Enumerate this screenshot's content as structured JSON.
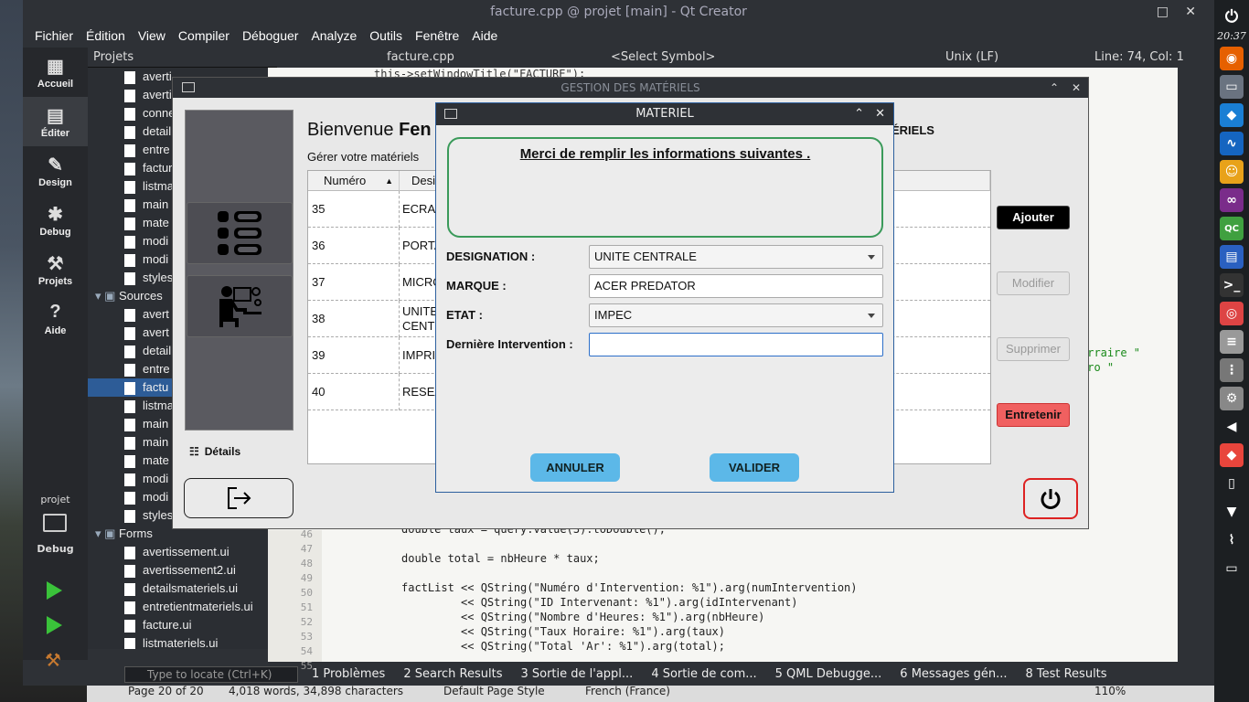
{
  "taskbar": {
    "clock": "20:37"
  },
  "qt": {
    "title": "facture.cpp @ projet [main] - Qt Creator",
    "menu": [
      "Fichier",
      "Édition",
      "View",
      "Compiler",
      "Déboguer",
      "Analyze",
      "Outils",
      "Fenêtre",
      "Aide"
    ],
    "modes": [
      "Accueil",
      "Éditer",
      "Design",
      "Debug",
      "Projets",
      "Aide"
    ],
    "kit": {
      "project": "projet",
      "mode": "Debug"
    },
    "projects_label": "Projets",
    "tree": [
      {
        "label": "averti",
        "sel": false
      },
      {
        "label": "averti",
        "sel": false
      },
      {
        "label": "conne",
        "sel": false
      },
      {
        "label": "detail",
        "sel": false
      },
      {
        "label": "entre",
        "sel": false
      },
      {
        "label": "factur",
        "sel": false
      },
      {
        "label": "listma",
        "sel": false
      },
      {
        "label": "main",
        "sel": false
      },
      {
        "label": "mate",
        "sel": false
      },
      {
        "label": "modi",
        "sel": false
      },
      {
        "label": "modi",
        "sel": false
      },
      {
        "label": "styles",
        "sel": false
      },
      {
        "label": "Sources",
        "sel": false,
        "folder": true
      },
      {
        "label": "avert",
        "sel": false
      },
      {
        "label": "avert",
        "sel": false
      },
      {
        "label": "detail",
        "sel": false
      },
      {
        "label": "entre",
        "sel": false
      },
      {
        "label": "factu",
        "sel": true
      },
      {
        "label": "listma",
        "sel": false
      },
      {
        "label": "main",
        "sel": false
      },
      {
        "label": "main",
        "sel": false
      },
      {
        "label": "mate",
        "sel": false
      },
      {
        "label": "modi",
        "sel": false
      },
      {
        "label": "modi",
        "sel": false
      },
      {
        "label": "styles",
        "sel": false
      },
      {
        "label": "Forms",
        "sel": false,
        "folder": true
      },
      {
        "label": "avertissement.ui",
        "sel": false
      },
      {
        "label": "avertissement2.ui",
        "sel": false
      },
      {
        "label": "detailsmateriels.ui",
        "sel": false
      },
      {
        "label": "entretientmateriels.ui",
        "sel": false
      },
      {
        "label": "facture.ui",
        "sel": false
      },
      {
        "label": "listmateriels.ui",
        "sel": false
      }
    ],
    "editor_tab": "facture.cpp",
    "symbol": "<Select Symbol>",
    "line_ending": "Unix (LF)",
    "position": "Line: 74, Col: 1",
    "locate_placeholder": "Type to locate (Ctrl+K)",
    "output_tabs": [
      "1  Problèmes",
      "2  Search Results",
      "3  Sortie de l'appl...",
      "4  Sortie de com...",
      "5  QML Debugge...",
      "6  Messages gén...",
      "8  Test Results"
    ],
    "code_lines": [
      {
        "n": "46",
        "t": "double taux = query.value(3).toDouble();"
      },
      {
        "n": "47",
        "t": ""
      },
      {
        "n": "48",
        "t": "double total = nbHeure * taux;"
      },
      {
        "n": "49",
        "t": ""
      },
      {
        "n": "50",
        "t": "factList << QString(\"Numéro d'Intervention: %1\").arg(numIntervention)"
      },
      {
        "n": "51",
        "t": "         << QString(\"ID Intervenant: %1\").arg(idIntervenant)"
      },
      {
        "n": "52",
        "t": "         << QString(\"Nombre d'Heures: %1\").arg(nbHeure)"
      },
      {
        "n": "53",
        "t": "         << QString(\"Taux Horaire: %1\").arg(taux)"
      },
      {
        "n": "54",
        "t": "         << QString(\"Total 'Ar': %1\").arg(total);"
      },
      {
        "n": "55",
        "t": ""
      }
    ],
    "code_top": "this->setWindowTitle(\"FACTURE\");",
    "code_side1": "orraire \"",
    "code_side2": "ero \""
  },
  "writer": {
    "page": "Page 20 of 20",
    "words": "4,018 words, 34,898 characters",
    "style": "Default Page Style",
    "lang": "French (France)",
    "zoom": "110%"
  },
  "gestion": {
    "title": "GESTION DES MATÉRIELS",
    "welcome_prefix": "Bienvenue",
    "welcome_bold": "Fen",
    "header_right": "ÉRIELS",
    "manage": "Gérer votre matériels",
    "columns": [
      "Numéro",
      "Desi"
    ],
    "rows": [
      {
        "num": "35",
        "des": "ECRAN"
      },
      {
        "num": "36",
        "des": "PORTA"
      },
      {
        "num": "37",
        "des": "MICRO"
      },
      {
        "num": "38",
        "des": "UNITE\nCENTR"
      },
      {
        "num": "39",
        "des": "IMPRI"
      },
      {
        "num": "40",
        "des": "RESEA"
      }
    ],
    "buttons": {
      "add": "Ajouter",
      "edit": "Modifier",
      "delete": "Supprimer",
      "maint": "Entretenir"
    },
    "details": "Détails"
  },
  "materiel": {
    "title": "MATERIEL",
    "heading": "Merci de remplir les informations suivantes .",
    "fields": {
      "designation_label": "DESIGNATION :",
      "designation_value": "UNITE CENTRALE",
      "marque_label": "MARQUE :",
      "marque_value": "ACER PREDATOR",
      "etat_label": "ETAT :",
      "etat_value": "IMPEC",
      "intervention_label": "Dernière Intervention :",
      "intervention_value": ""
    },
    "cancel": "ANNULER",
    "validate": "VALIDER"
  }
}
